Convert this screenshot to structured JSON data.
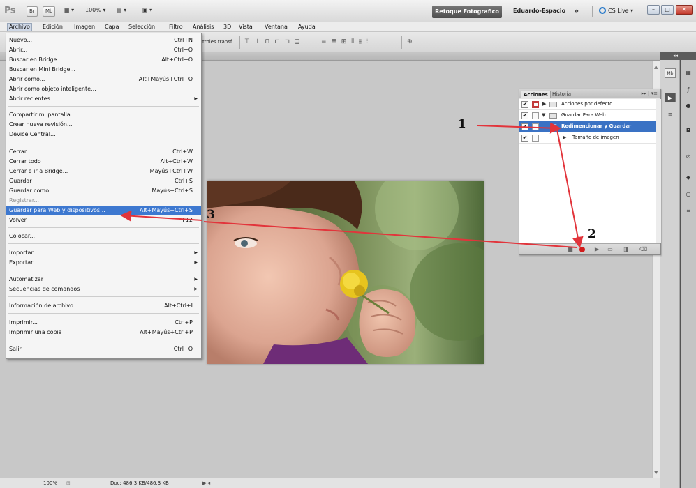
{
  "appbar": {
    "logo": "Ps",
    "btn_bridge": "Br",
    "btn_minibridge": "Mb",
    "zoom": "100%",
    "workspace_active": "Retoque Fotografico",
    "workspace_user": "Eduardo-Espacio",
    "more": "»",
    "cs_live": "CS Live ▾"
  },
  "menubar": {
    "items": [
      "Archivo",
      "Edición",
      "Imagen",
      "Capa",
      "Selección",
      "Filtro",
      "Análisis",
      "3D",
      "Vista",
      "Ventana",
      "Ayuda"
    ]
  },
  "optionsbar": {
    "label": "troles transf."
  },
  "archivo_menu": {
    "items": [
      {
        "label": "Nuevo...",
        "shortcut": "Ctrl+N"
      },
      {
        "label": "Abrir...",
        "shortcut": "Ctrl+O"
      },
      {
        "label": "Buscar en Bridge...",
        "shortcut": "Alt+Ctrl+O"
      },
      {
        "label": "Buscar en Mini Bridge...",
        "shortcut": ""
      },
      {
        "label": "Abrir como...",
        "shortcut": "Alt+Mayús+Ctrl+O"
      },
      {
        "label": "Abrir como objeto inteligente...",
        "shortcut": ""
      },
      {
        "label": "Abrir recientes",
        "shortcut": ""
      },
      {
        "label": "Compartir mi pantalla...",
        "shortcut": ""
      },
      {
        "label": "Crear nueva revisión...",
        "shortcut": ""
      },
      {
        "label": "Device Central...",
        "shortcut": ""
      },
      {
        "label": "Cerrar",
        "shortcut": "Ctrl+W"
      },
      {
        "label": "Cerrar todo",
        "shortcut": "Alt+Ctrl+W"
      },
      {
        "label": "Cerrar e ir a Bridge...",
        "shortcut": "Mayús+Ctrl+W"
      },
      {
        "label": "Guardar",
        "shortcut": "Ctrl+S"
      },
      {
        "label": "Guardar como...",
        "shortcut": "Mayús+Ctrl+S"
      },
      {
        "label": "Registrar...",
        "shortcut": ""
      },
      {
        "label": "Guardar para Web y dispositivos...",
        "shortcut": "Alt+Mayús+Ctrl+S"
      },
      {
        "label": "Volver",
        "shortcut": "F12"
      },
      {
        "label": "Colocar...",
        "shortcut": ""
      },
      {
        "label": "Importar",
        "shortcut": ""
      },
      {
        "label": "Exportar",
        "shortcut": ""
      },
      {
        "label": "Automatizar",
        "shortcut": ""
      },
      {
        "label": "Secuencias de comandos",
        "shortcut": ""
      },
      {
        "label": "Información de archivo...",
        "shortcut": "Alt+Ctrl+I"
      },
      {
        "label": "Imprimir...",
        "shortcut": "Ctrl+P"
      },
      {
        "label": "Imprimir una copia",
        "shortcut": "Alt+Mayús+Ctrl+P"
      },
      {
        "label": "Salir",
        "shortcut": "Ctrl+Q"
      }
    ]
  },
  "actions_panel": {
    "tab_active": "Acciones",
    "tab_other": "Historia",
    "rows": [
      {
        "label": "Acciones por defecto"
      },
      {
        "label": "Guardar Para Web"
      },
      {
        "label": "Redimencionar y Guardar"
      },
      {
        "label": "Tamaño de imagen"
      }
    ]
  },
  "status": {
    "zoom": "100%",
    "doc": "Doc: 486.3 KB/486.3 KB"
  },
  "annotations": {
    "n1": "1",
    "n2": "2",
    "n3": "3"
  },
  "colors": {
    "highlight": "#3d78d0",
    "arrow": "#e2343b",
    "record": "#d11c1c"
  }
}
